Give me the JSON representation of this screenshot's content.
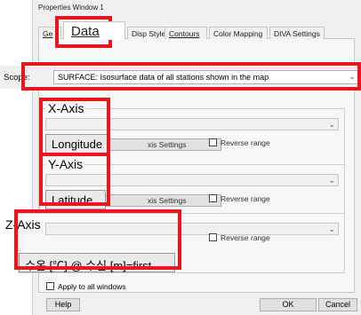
{
  "window": {
    "title": "Properties Window 1"
  },
  "tabs": [
    {
      "label": "Ge"
    },
    {
      "label": "Data"
    },
    {
      "label": "Disp Style"
    },
    {
      "label": "Contours"
    },
    {
      "label": "Color Mapping"
    },
    {
      "label": "DIVA Settings"
    }
  ],
  "scope": {
    "label": "Scope:",
    "value": "SURFACE: Isosurface data of all stations shown in the map"
  },
  "x_axis": {
    "title": "X-Axis",
    "value": "Longitude",
    "settings_label": "xis Settings",
    "reverse_label": "Reverse range"
  },
  "y_axis": {
    "title": "Y-Axis",
    "value": "Latitude",
    "settings_label": "xis Settings",
    "reverse_label": "Reverse range"
  },
  "z_axis": {
    "title": "Z-Axis",
    "value": "수온 [℃] @ 수심 [m]=first",
    "reverse_label": "Reverse range"
  },
  "apply_all": {
    "label": "Apply to all windows"
  },
  "buttons": {
    "help": "Help",
    "ok": "OK",
    "cancel": "Cancel"
  },
  "colors": {
    "highlight": "#e8161d",
    "dialog_bg": "#f0f0f0"
  },
  "icons": {
    "dropdown": "chevron-down-icon",
    "checkbox": "checkbox-icon"
  }
}
